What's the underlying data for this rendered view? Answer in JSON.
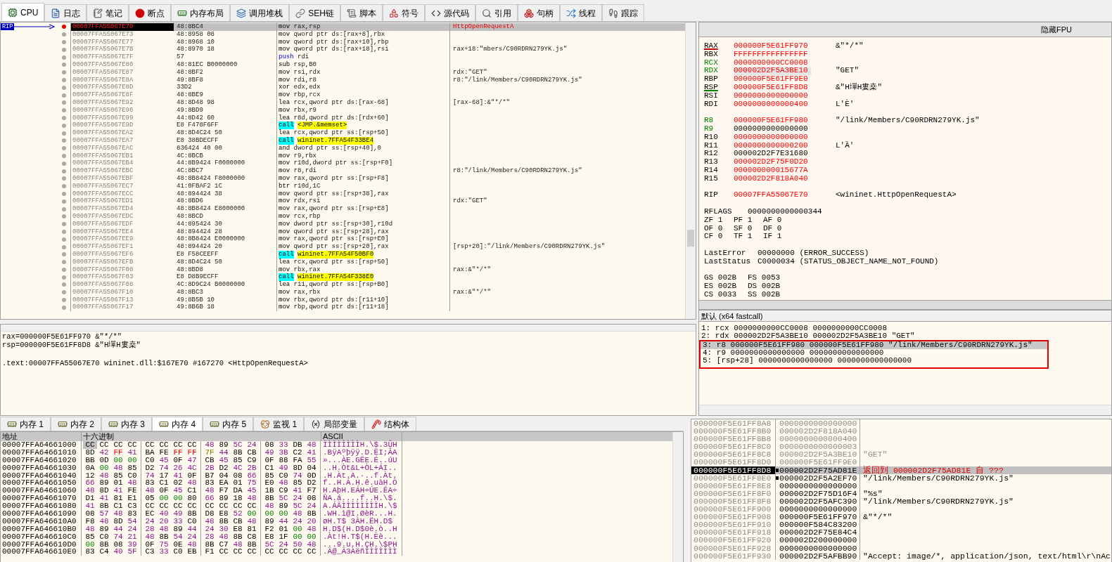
{
  "tabs": [
    {
      "label": "CPU",
      "selected": true
    },
    {
      "label": "日志",
      "selected": false
    },
    {
      "label": "笔记",
      "selected": false
    },
    {
      "label": "断点",
      "selected": false
    },
    {
      "label": "内存布局",
      "selected": false
    },
    {
      "label": "调用堆栈",
      "selected": false
    },
    {
      "label": "SEH链",
      "selected": false
    },
    {
      "label": "脚本",
      "selected": false
    },
    {
      "label": "符号",
      "selected": false
    },
    {
      "label": "源代码",
      "selected": false
    },
    {
      "label": "引用",
      "selected": false
    },
    {
      "label": "句柄",
      "selected": false
    },
    {
      "label": "线程",
      "selected": false
    },
    {
      "label": "跟踪",
      "selected": false
    }
  ],
  "disassembly": {
    "rip_label": "RIP",
    "rows": [
      {
        "address": "00007FFA55067E70",
        "bytes": "48:8BC4",
        "mnemonic": "mov",
        "operands": "rax,rsp",
        "label": "HttpOpenRequestA",
        "kind": "plain",
        "selected": true,
        "breakpoint": true
      },
      {
        "address": "00007FFA55067E73",
        "bytes": "48:8958 08",
        "mnemonic": "mov",
        "operands": "qword ptr ds:[rax+8],rbx",
        "kind": "plain",
        "selected": false,
        "breakpoint": false
      },
      {
        "address": "00007FFA55067E77",
        "bytes": "48:8968 10",
        "mnemonic": "mov",
        "operands": "qword ptr ds:[rax+10],rbp",
        "kind": "plain",
        "selected": false,
        "breakpoint": false
      },
      {
        "address": "00007FFA55067E7B",
        "bytes": "48:8970 18",
        "mnemonic": "mov",
        "operands": "qword ptr ds:[rax+18],rsi",
        "comment": "rax+18:\"mbers/C90RDRN279YK.js\"",
        "kind": "plain",
        "selected": false,
        "breakpoint": false
      },
      {
        "address": "00007FFA55067E7F",
        "bytes": "57",
        "mnemonic": "push",
        "operands": "rdi",
        "kind": "stack",
        "selected": false,
        "breakpoint": false
      },
      {
        "address": "00007FFA55067E80",
        "bytes": "48:81EC B0000000",
        "mnemonic": "sub",
        "operands": "rsp,B0",
        "kind": "plain",
        "selected": false,
        "breakpoint": false
      },
      {
        "address": "00007FFA55067E87",
        "bytes": "48:8BF2",
        "mnemonic": "mov",
        "operands": "rsi,rdx",
        "comment": "rdx:\"GET\"",
        "kind": "plain",
        "selected": false,
        "breakpoint": false
      },
      {
        "address": "00007FFA55067E8A",
        "bytes": "49:8BF8",
        "mnemonic": "mov",
        "operands": "rdi,r8",
        "comment": "r8:\"/link/Members/C90RDRN279YK.js\"",
        "kind": "plain",
        "selected": false,
        "breakpoint": false
      },
      {
        "address": "00007FFA55067E8D",
        "bytes": "33D2",
        "mnemonic": "xor",
        "operands": "edx,edx",
        "kind": "plain",
        "selected": false,
        "breakpoint": false
      },
      {
        "address": "00007FFA55067E8F",
        "bytes": "48:8BE9",
        "mnemonic": "mov",
        "operands": "rbp,rcx",
        "kind": "plain",
        "selected": false,
        "breakpoint": false
      },
      {
        "address": "00007FFA55067E92",
        "bytes": "48:8D48 98",
        "mnemonic": "lea",
        "operands": "rcx,qword ptr ds:[rax-68]",
        "comment": "[rax-68]:&\"*/*\"",
        "kind": "plain",
        "selected": false,
        "breakpoint": false
      },
      {
        "address": "00007FFA55067E96",
        "bytes": "49:8BD9",
        "mnemonic": "mov",
        "operands": "rbx,r9",
        "kind": "plain",
        "selected": false,
        "breakpoint": false
      },
      {
        "address": "00007FFA55067E99",
        "bytes": "44:8D42 60",
        "mnemonic": "lea",
        "operands": "r8d,qword ptr ds:[rdx+60]",
        "kind": "plain",
        "selected": false,
        "breakpoint": false
      },
      {
        "address": "00007FFA55067E9D",
        "bytes": "E8 F478F6FF",
        "mnemonic": "call",
        "operands": "<JMP.&memset>",
        "kind": "call",
        "selected": false,
        "breakpoint": false
      },
      {
        "address": "00007FFA55067EA2",
        "bytes": "48:8D4C24 50",
        "mnemonic": "lea",
        "operands": "rcx,qword ptr ss:[rsp+50]",
        "kind": "plain",
        "selected": false,
        "breakpoint": false
      },
      {
        "address": "00007FFA55067EA7",
        "bytes": "E8 38BDECFF",
        "mnemonic": "call",
        "operands": "wininet.7FFA54F33BE4",
        "kind": "call",
        "selected": false,
        "breakpoint": false
      },
      {
        "address": "00007FFA55067EAC",
        "bytes": "836424 40 00",
        "mnemonic": "and",
        "operands": "dword ptr ss:[rsp+40],0",
        "kind": "plain",
        "selected": false,
        "breakpoint": false
      },
      {
        "address": "00007FFA55067EB1",
        "bytes": "4C:8BCB",
        "mnemonic": "mov",
        "operands": "r9,rbx",
        "kind": "plain",
        "selected": false,
        "breakpoint": false
      },
      {
        "address": "00007FFA55067EB4",
        "bytes": "44:8B9424 F0000000",
        "mnemonic": "mov",
        "operands": "r10d,dword ptr ss:[rsp+F0]",
        "kind": "plain",
        "selected": false,
        "breakpoint": false
      },
      {
        "address": "00007FFA55067EBC",
        "bytes": "4C:8BC7",
        "mnemonic": "mov",
        "operands": "r8,rdi",
        "comment": "r8:\"/link/Members/C90RDRN279YK.js\"",
        "kind": "plain",
        "selected": false,
        "breakpoint": false
      },
      {
        "address": "00007FFA55067EBF",
        "bytes": "48:8B8424 F8000000",
        "mnemonic": "mov",
        "operands": "rax,qword ptr ss:[rsp+F8]",
        "kind": "plain",
        "selected": false,
        "breakpoint": false
      },
      {
        "address": "00007FFA55067EC7",
        "bytes": "41:0FBAF2 1C",
        "mnemonic": "btr",
        "operands": "r10d,1C",
        "kind": "plain",
        "selected": false,
        "breakpoint": false
      },
      {
        "address": "00007FFA55067ECC",
        "bytes": "48:894424 38",
        "mnemonic": "mov",
        "operands": "qword ptr ss:[rsp+38],rax",
        "kind": "plain",
        "selected": false,
        "breakpoint": false
      },
      {
        "address": "00007FFA55067ED1",
        "bytes": "48:8BD6",
        "mnemonic": "mov",
        "operands": "rdx,rsi",
        "comment": "rdx:\"GET\"",
        "kind": "plain",
        "selected": false,
        "breakpoint": false
      },
      {
        "address": "00007FFA55067ED4",
        "bytes": "48:8B8424 E8000000",
        "mnemonic": "mov",
        "operands": "rax,qword ptr ss:[rsp+E8]",
        "kind": "plain",
        "selected": false,
        "breakpoint": false
      },
      {
        "address": "00007FFA55067EDC",
        "bytes": "48:8BCD",
        "mnemonic": "mov",
        "operands": "rcx,rbp",
        "kind": "plain",
        "selected": false,
        "breakpoint": false
      },
      {
        "address": "00007FFA55067EDF",
        "bytes": "44:895424 30",
        "mnemonic": "mov",
        "operands": "dword ptr ss:[rsp+30],r10d",
        "kind": "plain",
        "selected": false,
        "breakpoint": false
      },
      {
        "address": "00007FFA55067EE4",
        "bytes": "48:894424 28",
        "mnemonic": "mov",
        "operands": "qword ptr ss:[rsp+28],rax",
        "kind": "plain",
        "selected": false,
        "breakpoint": false
      },
      {
        "address": "00007FFA55067EE9",
        "bytes": "48:8B8424 E0000000",
        "mnemonic": "mov",
        "operands": "rax,qword ptr ss:[rsp+E0]",
        "kind": "plain",
        "selected": false,
        "breakpoint": false
      },
      {
        "address": "00007FFA55067EF1",
        "bytes": "48:894424 20",
        "mnemonic": "mov",
        "operands": "qword ptr ss:[rsp+20],rax",
        "comment": "[rsp+20]:\"/link/Members/C90RDRN279YK.js\"",
        "kind": "plain",
        "selected": false,
        "breakpoint": false
      },
      {
        "address": "00007FFA55067EF6",
        "bytes": "E8 F58CEEFF",
        "mnemonic": "call",
        "operands": "wininet.7FFA54F50BF0",
        "kind": "call",
        "selected": false,
        "breakpoint": false
      },
      {
        "address": "00007FFA55067EFB",
        "bytes": "48:8D4C24 50",
        "mnemonic": "lea",
        "operands": "rcx,qword ptr ss:[rsp+50]",
        "kind": "plain",
        "selected": false,
        "breakpoint": false
      },
      {
        "address": "00007FFA55067F00",
        "bytes": "48:8BD8",
        "mnemonic": "mov",
        "operands": "rbx,rax",
        "comment": "rax:&\"*/*\"",
        "kind": "plain",
        "selected": false,
        "breakpoint": false
      },
      {
        "address": "00007FFA55067F03",
        "bytes": "E8 D8B9ECFF",
        "mnemonic": "call",
        "operands": "wininet.7FFA54F338E0",
        "kind": "call",
        "selected": false,
        "breakpoint": false
      },
      {
        "address": "00007FFA55067F08",
        "bytes": "4C:8D9C24 B0000000",
        "mnemonic": "lea",
        "operands": "r11,qword ptr ss:[rsp+B0]",
        "kind": "plain",
        "selected": false,
        "breakpoint": false
      },
      {
        "address": "00007FFA55067F10",
        "bytes": "48:8BC3",
        "mnemonic": "mov",
        "operands": "rax,rbx",
        "comment": "rax:&\"*/*\"",
        "kind": "plain",
        "selected": false,
        "breakpoint": false
      },
      {
        "address": "00007FFA55067F13",
        "bytes": "49:8B5B 10",
        "mnemonic": "mov",
        "operands": "rbx,qword ptr ds:[r11+10]",
        "kind": "plain",
        "selected": false,
        "breakpoint": false
      },
      {
        "address": "00007FFA55067F17",
        "bytes": "49:8B6B 18",
        "mnemonic": "mov",
        "operands": "rbp,qword ptr ds:[r11+18]",
        "kind": "plain",
        "selected": false,
        "breakpoint": false
      }
    ]
  },
  "registers": {
    "fpu_button": "隐藏FPU",
    "groups": [
      [
        {
          "name": "RAX",
          "value": "000000F5E61FF970",
          "comment": "&\"*/*\"",
          "changed": true,
          "color": "#000000",
          "underline": {
            "color": "#c00000"
          },
          "selected": false
        },
        {
          "name": "RBX",
          "value": "FFFFFFFFFFFFFFFF",
          "changed": true,
          "color": "#000000",
          "selected": false
        },
        {
          "name": "RCX",
          "value": "0000000000CC0008",
          "changed": true,
          "color": "#008000",
          "selected": false
        },
        {
          "name": "RDX",
          "value": "000002D2F5A3BE10",
          "comment": "\"GET\"",
          "changed": true,
          "color": "#008000",
          "selected": true
        },
        {
          "name": "RBP",
          "value": "000000F5E61FF9E0",
          "changed": true,
          "color": "#000000",
          "selected": false
        },
        {
          "name": "RSP",
          "value": "000000F5E61FF8D8",
          "comment": "&\"H墠H婁桒\"",
          "changed": true,
          "color": "#000000",
          "underline": {
            "color": "#008000"
          },
          "selected": false
        },
        {
          "name": "RSI",
          "value": "0000000000000000",
          "changed": true,
          "color": "#000000",
          "selected": false
        },
        {
          "name": "RDI",
          "value": "0000000000000400",
          "comment": "L'Ѐ'",
          "changed": true,
          "color": "#000000",
          "selected": false
        }
      ],
      [
        {
          "name": "R8",
          "value": "000000F5E61FF980",
          "comment": "\"/link/Members/C90RDRN279YK.js\"",
          "changed": true,
          "color": "#008000",
          "selected": false
        },
        {
          "name": "R9",
          "value": "0000000000000000",
          "changed": false,
          "color": "#008000",
          "selected": false
        },
        {
          "name": "R10",
          "value": "0000000000000000",
          "changed": true,
          "color": "#000000",
          "selected": false
        },
        {
          "name": "R11",
          "value": "0000000000000200",
          "comment": "L'Ȁ'",
          "changed": true,
          "color": "#000000",
          "selected": false
        },
        {
          "name": "R12",
          "value": "000002D2F7E31680",
          "changed": false,
          "color": "#000000",
          "selected": false
        },
        {
          "name": "R13",
          "value": "000002D2F75F0D20",
          "changed": true,
          "color": "#000000",
          "selected": false
        },
        {
          "name": "R14",
          "value": "000000000015677A",
          "changed": true,
          "color": "#000000",
          "selected": false
        },
        {
          "name": "R15",
          "value": "000002D2F818A040",
          "changed": true,
          "color": "#000000",
          "selected": false
        }
      ],
      [
        {
          "name": "RIP",
          "value": "00007FFA55067E70",
          "comment": "<wininet.HttpOpenRequestA>",
          "changed": true,
          "color": "#000000",
          "selected": false
        }
      ]
    ],
    "rflags": {
      "name": "RFLAGS",
      "value": "0000000000000344"
    },
    "flags": [
      [
        "ZF 1",
        "PF 1",
        "AF 0"
      ],
      [
        "OF 0",
        "SF 0",
        "DF 0"
      ],
      [
        "CF 0",
        "TF 1",
        "IF 1"
      ]
    ],
    "status": [
      {
        "name": "LastError",
        "value": "00000000 (ERROR_SUCCESS)"
      },
      {
        "name": "LastStatus",
        "value": "C0000034 (STATUS_OBJECT_NAME_NOT_FOUND)"
      }
    ],
    "segments": [
      [
        "GS 002B",
        "FS 0053"
      ],
      [
        "ES 002B",
        "DS 002B"
      ],
      [
        "CS 0033",
        "SS 002B"
      ]
    ]
  },
  "info": {
    "lines": [
      "rax=000000F5E61FF970 &\"*/*\"",
      "rsp=000000F5E61FF8D8 &\"H墠H婁桒\""
    ],
    "location": ".text:00007FFA55067E70 wininet.dll:$167E70 #167270 <HttpOpenRequestA>"
  },
  "arguments": {
    "convention": "默认 (x64 fastcall)",
    "lines": [
      {
        "text": "1: rcx 0000000000CC0008 0000000000CC0008",
        "selected": false,
        "annotated": false
      },
      {
        "text": "2: rdx 000002D2F5A3BE10 000002D2F5A3BE10 \"GET\"",
        "selected": false,
        "annotated": false
      },
      {
        "text": "3: r8 000000F5E61FF980 000000F5E61FF980 \"/link/Members/C90RDRN279YK.js\"",
        "selected": true,
        "annotated": true
      },
      {
        "text": "4: r9 0000000000000000 0000000000000000",
        "selected": false,
        "annotated": true
      },
      {
        "text": "5: [rsp+28] 0000000000000000 0000000000000000",
        "selected": false,
        "annotated": true
      }
    ]
  },
  "dump_tabs": [
    {
      "label": "内存 1",
      "selected": false
    },
    {
      "label": "内存 2",
      "selected": false
    },
    {
      "label": "内存 3",
      "selected": false
    },
    {
      "label": "内存 4",
      "selected": true
    },
    {
      "label": "内存 5",
      "selected": false
    },
    {
      "label": "监视 1",
      "selected": false
    },
    {
      "label": "局部变量",
      "selected": false
    },
    {
      "label": "结构体",
      "selected": false
    }
  ],
  "dump": {
    "columns": [
      "地址",
      "十六进制",
      "ASCII"
    ],
    "rows": [
      {
        "address": "00007FFA64661000",
        "hex": "CC CC CC CC CC CC CC CC 48 89 5C 24 08 33 DB 48",
        "ascii": "ÌÌÌÌÌÌÌÌH.\\$.3ÛH",
        "selected": true
      },
      {
        "address": "00007FFA64661010",
        "hex": "8D 42 FF 41 BA FE FF FF 7F 44 8B CB 49 3B C2 41",
        "ascii": ".BÿAºþÿÿ.D.ËI;ÂA",
        "selected": false
      },
      {
        "address": "00007FFA64661020",
        "hex": "BB 0D 00 00 C0 45 0F 47 CB 45 85 C9 0F 88 FA 55",
        "ascii": "»...ÀE.GËE.É..úU",
        "selected": false
      },
      {
        "address": "00007FFA64661030",
        "hex": "0A 00 48 85 D2 74 26 4C 2B D2 4C 2B C1 49 8D 04",
        "ascii": "..H.Òt&L+ÒL+ÁI..",
        "selected": false
      },
      {
        "address": "00007FFA64661040",
        "hex": "12 48 85 C0 74 17 41 0F B7 04 08 66 85 C0 74 0D",
        "ascii": ".H.Àt.A.·..f.Àt.",
        "selected": false
      },
      {
        "address": "00007FFA64661050",
        "hex": "66 89 01 48 83 C1 02 48 83 EA 01 75 E0 48 85 D2",
        "ascii": "f..H.Á.H.ê.uàH.Ò",
        "selected": false
      },
      {
        "address": "00007FFA64661060",
        "hex": "48 8D 41 FE 48 0F 45 C1 48 F7 DA 45 1B C9 41 F7",
        "ascii": "H.AþH.EÁH÷ÚE.ÉA÷",
        "selected": false
      },
      {
        "address": "00007FFA64661070",
        "hex": "D1 41 81 E1 05 00 00 80 66 89 18 48 8B 5C 24 08",
        "ascii": "ÑA.á....f..H.\\$.",
        "selected": false
      },
      {
        "address": "00007FFA64661080",
        "hex": "41 8B C1 C3 CC CC CC CC CC CC CC CC 48 89 5C 24",
        "ascii": "A.ÁÃÌÌÌÌÌÌÌÌH.\\$",
        "selected": false
      },
      {
        "address": "00007FFA64661090",
        "hex": "08 57 48 83 EC 40 49 8B D8 E8 52 00 00 00 48 8B",
        "ascii": ".WH.ì@I.ØèR...H.",
        "selected": false
      },
      {
        "address": "00007FFA646610A0",
        "hex": "F8 48 8D 54 24 20 33 C0 48 8B CB 48 89 44 24 20",
        "ascii": "øH.T$ 3ÀH.ËH.D$",
        "selected": false
      },
      {
        "address": "00007FFA646610B0",
        "hex": "48 89 44 24 28 48 89 44 24 30 E8 81 F2 01 00 48",
        "ascii": "H.D$(H.D$0è.ò..H",
        "selected": false
      },
      {
        "address": "00007FFA646610C0",
        "hex": "85 C0 74 21 48 8B 54 24 28 48 8B C8 E8 1F 00 00",
        "ascii": ".Àt!H.T$(H.Èè...",
        "selected": false
      },
      {
        "address": "00007FFA646610D0",
        "hex": "00 8B 08 39 0F 75 0E 48 8B C7 48 8B 5C 24 50 48",
        "ascii": "...9.u.H.ÇH.\\$PH",
        "selected": false
      },
      {
        "address": "00007FFA646610E0",
        "hex": "83 C4 40 5F C3 33 C0 EB F1 CC CC CC CC CC CC CC",
        "ascii": ".Ä@_Ã3ÀëñÌÌÌÌÌÌÌ",
        "selected": false
      }
    ]
  },
  "stack": {
    "rows": [
      {
        "address": "000000F5E61FF8A8",
        "value": "0000000000000000",
        "kind": "stale",
        "selected": false,
        "marker": false
      },
      {
        "address": "000000F5E61FF8B0",
        "value": "000002D2F818A040",
        "kind": "stale",
        "selected": false,
        "marker": false
      },
      {
        "address": "000000F5E61FF8B8",
        "value": "0000000000000400",
        "kind": "stale",
        "selected": false,
        "marker": false
      },
      {
        "address": "000000F5E61FF8C0",
        "value": "0000000000000003",
        "kind": "stale",
        "selected": false,
        "marker": false
      },
      {
        "address": "000000F5E61FF8C8",
        "value": "000002D2F5A3BE10",
        "comment": "\"GET\"",
        "kind": "stale",
        "selected": false,
        "marker": false
      },
      {
        "address": "000000F5E61FF8D0",
        "value": "000000F5E61FF9E0",
        "kind": "stale",
        "selected": false,
        "marker": false
      },
      {
        "address": "000000F5E61FF8D8",
        "value": "000002D2F75AD81E",
        "comment": "返回到 000002D2F75AD81E 自 ???",
        "kind": "return",
        "selected": true,
        "marker": true
      },
      {
        "address": "000000F5E61FF8E0",
        "value": "000002D2F5A2EF70",
        "comment": "\"/link/Members/C90RDRN279YK.js\"",
        "kind": "live",
        "selected": false,
        "marker": true
      },
      {
        "address": "000000F5E61FF8E8",
        "value": "0000000000000000",
        "kind": "live",
        "selected": false,
        "marker": false
      },
      {
        "address": "000000F5E61FF8F0",
        "value": "000002D2F75D16F4",
        "comment": "\"%s\"",
        "kind": "live",
        "selected": false,
        "marker": false
      },
      {
        "address": "000000F5E61FF8F8",
        "value": "000002D2F5AFC390",
        "comment": "\"/link/Members/C90RDRN279YK.js\"",
        "kind": "live",
        "selected": false,
        "marker": false
      },
      {
        "address": "000000F5E61FF900",
        "value": "0000000000000000",
        "kind": "live",
        "selected": false,
        "marker": false
      },
      {
        "address": "000000F5E61FF908",
        "value": "000000F5E61FF970",
        "comment": "&\"*/*\"",
        "kind": "live",
        "selected": false,
        "marker": false
      },
      {
        "address": "000000F5E61FF910",
        "value": "000000F584C83200",
        "kind": "live",
        "selected": false,
        "marker": false
      },
      {
        "address": "000000F5E61FF918",
        "value": "000002D2F75E84C4",
        "kind": "live",
        "selected": false,
        "marker": false
      },
      {
        "address": "000000F5E61FF920",
        "value": "000002D200000000",
        "kind": "live",
        "selected": false,
        "marker": false
      },
      {
        "address": "000000F5E61FF928",
        "value": "0000000000000000",
        "kind": "live",
        "selected": false,
        "marker": false
      },
      {
        "address": "000000F5E61FF930",
        "value": "000002D2F5AFBB90",
        "comment": "\"Accept: image/*, application/json, text/html\\r\\nAc",
        "kind": "live",
        "selected": false,
        "marker": false
      }
    ]
  }
}
